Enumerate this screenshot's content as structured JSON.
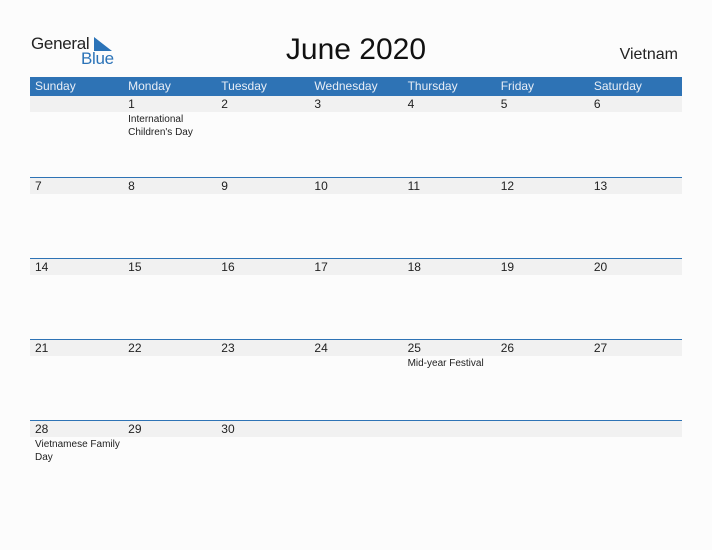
{
  "logo": {
    "general": "General",
    "blue": "Blue"
  },
  "title": "June 2020",
  "country": "Vietnam",
  "colors": {
    "accent": "#2e73b5",
    "date_strip": "#f1f1f1"
  },
  "weekdays": [
    "Sunday",
    "Monday",
    "Tuesday",
    "Wednesday",
    "Thursday",
    "Friday",
    "Saturday"
  ],
  "weeks": [
    [
      {
        "day": ""
      },
      {
        "day": "1",
        "event": "International Children's Day"
      },
      {
        "day": "2"
      },
      {
        "day": "3"
      },
      {
        "day": "4"
      },
      {
        "day": "5"
      },
      {
        "day": "6"
      }
    ],
    [
      {
        "day": "7"
      },
      {
        "day": "8"
      },
      {
        "day": "9"
      },
      {
        "day": "10"
      },
      {
        "day": "11"
      },
      {
        "day": "12"
      },
      {
        "day": "13"
      }
    ],
    [
      {
        "day": "14"
      },
      {
        "day": "15"
      },
      {
        "day": "16"
      },
      {
        "day": "17"
      },
      {
        "day": "18"
      },
      {
        "day": "19"
      },
      {
        "day": "20"
      }
    ],
    [
      {
        "day": "21"
      },
      {
        "day": "22"
      },
      {
        "day": "23"
      },
      {
        "day": "24"
      },
      {
        "day": "25",
        "event": "Mid-year Festival"
      },
      {
        "day": "26"
      },
      {
        "day": "27"
      }
    ],
    [
      {
        "day": "28",
        "event": "Vietnamese Family Day"
      },
      {
        "day": "29"
      },
      {
        "day": "30"
      },
      {
        "day": ""
      },
      {
        "day": ""
      },
      {
        "day": ""
      },
      {
        "day": ""
      }
    ]
  ]
}
